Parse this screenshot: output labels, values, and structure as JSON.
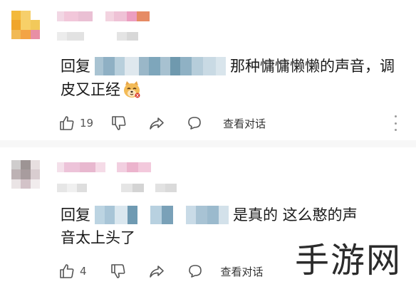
{
  "comments": [
    {
      "reply_prefix": "回复",
      "text_line1": "那种慵慵懒懒的声音，调",
      "text_line2": "皮又正经",
      "emoji": "dog-face-emoji",
      "likes": "19",
      "reply_action": "查看对话"
    },
    {
      "reply_prefix": "回复",
      "text_line1": "是真的 这么憨的声",
      "text_line2": "音太上头了",
      "likes": "4",
      "reply_action": "查看对话"
    }
  ],
  "watermark": "手游网",
  "icons": {
    "like": "thumbs-up-icon",
    "dislike": "thumbs-down-icon",
    "share": "share-icon",
    "comment": "comment-bubble-icon",
    "more": "more-vertical-icon"
  },
  "colors": {
    "text": "#1a1a1a",
    "secondary": "#666666",
    "divider": "#f7f7f7"
  }
}
